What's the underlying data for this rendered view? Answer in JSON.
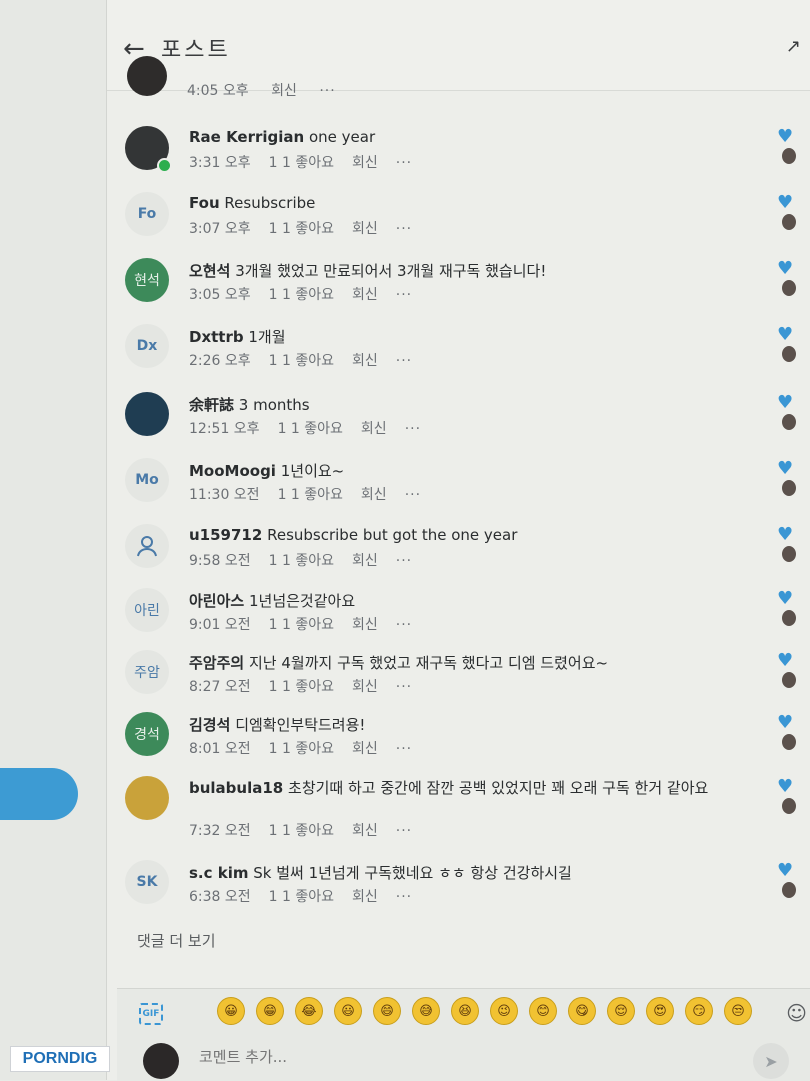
{
  "header": {
    "back_icon": "←",
    "title": "포스트",
    "share_icon": "↗"
  },
  "partial_comment": {
    "time": "4:05 오후",
    "reply": "회신",
    "more": "···"
  },
  "comments": [
    {
      "avatar": "",
      "user": "Rae Kerrigian",
      "text": "one year",
      "time": "3:31 오후",
      "likes": "1 1 좋아요",
      "reply": "회신",
      "more": "···"
    },
    {
      "avatar": "Fo",
      "user": "Fou",
      "text": "Resubscribe",
      "time": "3:07 오후",
      "likes": "1 1 좋아요",
      "reply": "회신",
      "more": "···"
    },
    {
      "avatar": "현석",
      "user": "오현석",
      "text": "3개월 했었고 만료되어서 3개월 재구독 했습니다!",
      "time": "3:05 오후",
      "likes": "1 1 좋아요",
      "reply": "회신",
      "more": "···"
    },
    {
      "avatar": "Dx",
      "user": "Dxttrb",
      "text": "1개월",
      "time": "2:26 오후",
      "likes": "1 1 좋아요",
      "reply": "회신",
      "more": "···"
    },
    {
      "avatar": "",
      "user": "余軒誌",
      "text": "3 months",
      "time": "12:51 오후",
      "likes": "1 1 좋아요",
      "reply": "회신",
      "more": "···"
    },
    {
      "avatar": "Mo",
      "user": "MooMoogi",
      "text": "1년이요~",
      "time": "11:30 오전",
      "likes": "1 1 좋아요",
      "reply": "회신",
      "more": "···"
    },
    {
      "avatar": "",
      "user": "u159712",
      "text": "Resubscribe but got the one year",
      "time": "9:58 오전",
      "likes": "1 1 좋아요",
      "reply": "회신",
      "more": "···"
    },
    {
      "avatar": "아린",
      "user": "아린아스",
      "text": "1년넘은것같아요",
      "time": "9:01 오전",
      "likes": "1 1 좋아요",
      "reply": "회신",
      "more": "···"
    },
    {
      "avatar": "주암",
      "user": "주암주의",
      "text": "지난 4월까지 구독 했었고 재구독 했다고 디엠 드렸어요~",
      "time": "8:27 오전",
      "likes": "1 1 좋아요",
      "reply": "회신",
      "more": "···"
    },
    {
      "avatar": "경석",
      "user": "김경석",
      "text": "디엠확인부탁드려용!",
      "time": "8:01 오전",
      "likes": "1 1 좋아요",
      "reply": "회신",
      "more": "···"
    },
    {
      "avatar": "",
      "user": "bulabula18",
      "text": "초창기때 하고 중간에 잠깐 공백 있었지만 꽤 오래 구독 한거 같아요",
      "time": "7:32 오전",
      "likes": "1 1 좋아요",
      "reply": "회신",
      "more": "···"
    },
    {
      "avatar": "SK",
      "user": "s.c kim",
      "text": "Sk 벌써 1년넘게 구독했네요 ㅎㅎ 항상 건강하시길",
      "time": "6:38 오전",
      "likes": "1 1 좋아요",
      "reply": "회신",
      "more": "···"
    }
  ],
  "more_comments": "댓글 더 보기",
  "composer": {
    "gif_label": "GIF",
    "emojis": [
      "😀",
      "😁",
      "😂",
      "😃",
      "😄",
      "😅",
      "😆",
      "😉",
      "😊",
      "😋",
      "😌",
      "😍",
      "😏",
      "😒"
    ],
    "placeholder": "코멘트 추가...",
    "send_icon": "➤"
  },
  "watermark": "PORNDIG",
  "icons": {
    "heart": "♥",
    "outline_smile": "☺"
  }
}
